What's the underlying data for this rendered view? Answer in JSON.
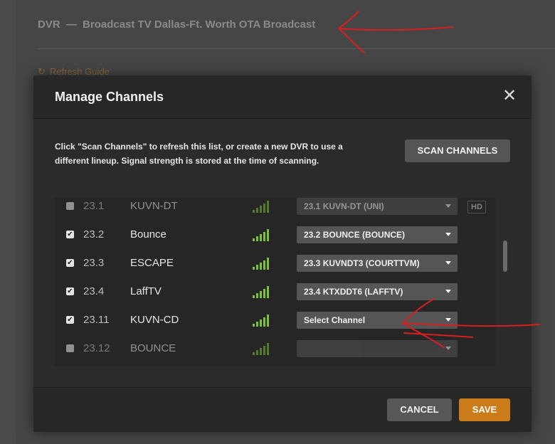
{
  "background": {
    "dvr_prefix": "DVR",
    "separator": "—",
    "dvr_name": "Broadcast TV Dallas-Ft. Worth OTA Broadcast",
    "refresh_label": "Refresh Guide"
  },
  "modal": {
    "title": "Manage Channels",
    "close_icon": "close-icon",
    "description": "Click \"Scan Channels\" to refresh this list, or create a new DVR to use a different lineup. Signal strength is stored at the time of scanning.",
    "scan_label": "SCAN CHANNELS",
    "cancel_label": "CANCEL",
    "save_label": "SAVE"
  },
  "channels": [
    {
      "checked": false,
      "number": "23.1",
      "name": "KUVN-DT",
      "selection": "23.1 KUVN-DT (UNI)",
      "hd": "HD",
      "dim": true
    },
    {
      "checked": true,
      "number": "23.2",
      "name": "Bounce",
      "selection": "23.2 BOUNCE (BOUNCE)",
      "hd": "",
      "dim": false
    },
    {
      "checked": true,
      "number": "23.3",
      "name": "ESCAPE",
      "selection": "23.3 KUVNDT3 (COURTTVM)",
      "hd": "",
      "dim": false
    },
    {
      "checked": true,
      "number": "23.4",
      "name": "LaffTV",
      "selection": "23.4 KTXDDT6 (LAFFTV)",
      "hd": "",
      "dim": false
    },
    {
      "checked": true,
      "number": "23.11",
      "name": "KUVN-CD",
      "selection": "Select Channel",
      "hd": "",
      "dim": false
    },
    {
      "checked": false,
      "number": "23.12",
      "name": "BOUNCE",
      "selection": "",
      "hd": "",
      "dim": true
    }
  ],
  "colors": {
    "accent": "#cc7b19",
    "signal": "#7cc23a",
    "annotation": "#d62020"
  },
  "icons": {
    "refresh": "refresh-icon",
    "signal": "signal-strength-icon",
    "checkbox": "checkbox-icon"
  }
}
